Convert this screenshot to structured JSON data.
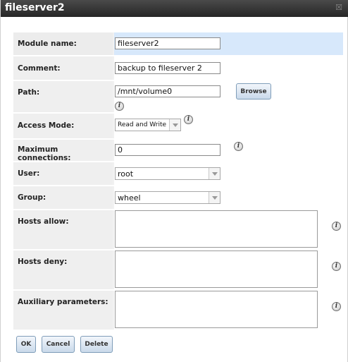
{
  "window": {
    "title": "fileserver2",
    "close_glyph": "☒"
  },
  "form": {
    "module_name": {
      "label": "Module name:",
      "value": "fileserver2"
    },
    "comment": {
      "label": "Comment:",
      "value": "backup to fileserver 2"
    },
    "path": {
      "label": "Path:",
      "value": "/mnt/volume0",
      "browse_label": "Browse"
    },
    "access_mode": {
      "label": "Access Mode:",
      "value": "Read and Write"
    },
    "max_connections": {
      "label": "Maximum connections:",
      "value": "0"
    },
    "user": {
      "label": "User:",
      "value": "root"
    },
    "group": {
      "label": "Group:",
      "value": "wheel"
    },
    "hosts_allow": {
      "label": "Hosts allow:",
      "value": ""
    },
    "hosts_deny": {
      "label": "Hosts deny:",
      "value": ""
    },
    "auxiliary": {
      "label": "Auxiliary parameters:",
      "value": ""
    }
  },
  "info_glyph": "i",
  "buttons": {
    "ok": "OK",
    "cancel": "Cancel",
    "delete": "Delete"
  },
  "colors": {
    "highlight_row": "#d7e8fb",
    "titlebar": "#333333",
    "button_border": "#7f9db9"
  }
}
